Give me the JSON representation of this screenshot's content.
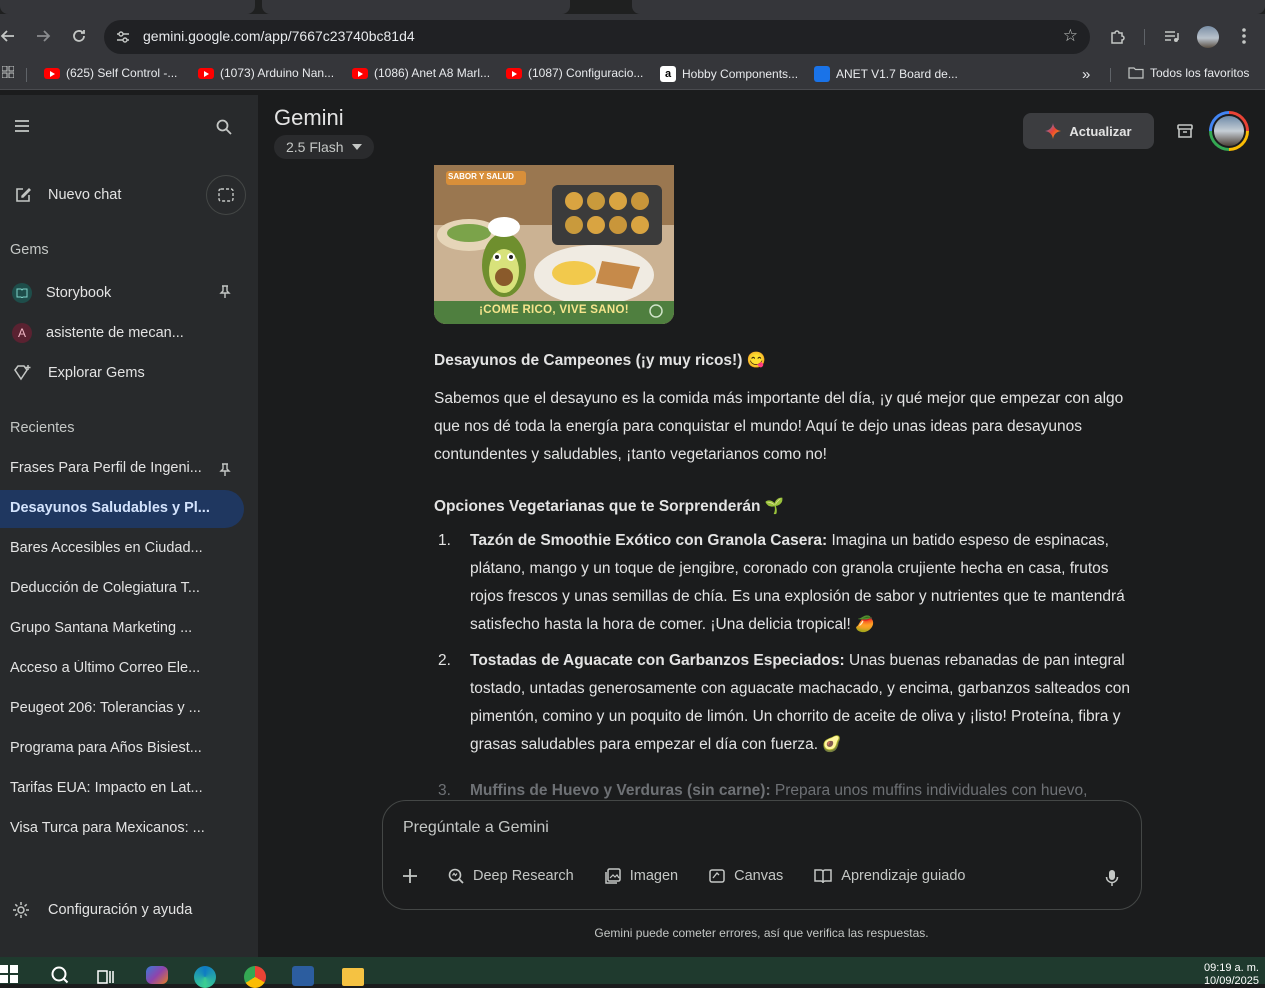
{
  "browser": {
    "url": "gemini.google.com/app/7667c23740bc81d4",
    "bookmarks": [
      {
        "icon": "youtube-icon",
        "label": "(625) Self Control -..."
      },
      {
        "icon": "youtube-icon",
        "label": "(1073) Arduino Nan..."
      },
      {
        "icon": "youtube-icon",
        "label": "(1086) Anet A8 Marl..."
      },
      {
        "icon": "youtube-icon",
        "label": "(1087) Configuracio..."
      },
      {
        "icon": "amazon-icon",
        "label": "Hobby Components..."
      },
      {
        "icon": "globe-icon",
        "label": "ANET V1.7 Board de..."
      }
    ],
    "all_bookmarks": "Todos los favoritos"
  },
  "sidebar": {
    "new_chat": "Nuevo chat",
    "gems_title": "Gems",
    "gems": [
      {
        "icon": "storybook-icon",
        "label": "Storybook"
      },
      {
        "icon": "avatar-a",
        "label": "asistente de mecan..."
      },
      {
        "icon": "gem-plus-icon",
        "label": "Explorar Gems"
      }
    ],
    "avatar_letter": "A",
    "recents_title": "Recientes",
    "recents": [
      "Frases Para Perfil de Ingeni...",
      "Desayunos Saludables y Pl...",
      "Bares Accesibles en Ciudad...",
      "Deducción de Colegiatura T...",
      "Grupo Santana Marketing ...",
      "Acceso a Último Correo Ele...",
      "Peugeot 206: Tolerancias y ...",
      "Programa para Años Bisiest...",
      "Tarifas EUA: Impacto en Lat...",
      "Visa Turca para Mexicanos: ..."
    ],
    "settings": "Configuración y ayuda"
  },
  "header": {
    "brand": "Gemini",
    "model": "2.5 Flash",
    "upgrade": "Actualizar"
  },
  "image": {
    "badge": "SABOR Y SALUD",
    "caption": "¡COME RICO, VIVE SANO!"
  },
  "response": {
    "heading": "Desayunos de Campeones (¡y muy ricos!) 😋",
    "intro": "Sabemos que el desayuno es la comida más importante del día, ¡y qué mejor que empezar con algo que nos dé toda la energía para conquistar el mundo! Aquí te dejo unas ideas para desayunos contundentes y saludables, ¡tanto vegetarianos como no!",
    "subheading": "Opciones Vegetarianas que te Sorprenderán 🌱",
    "items": [
      {
        "num": "1.",
        "title": "Tazón de Smoothie Exótico con Granola Casera:",
        "text": " Imagina un batido espeso de espinacas, plátano, mango y un toque de jengibre, coronado con granola crujiente hecha en casa, frutos rojos frescos y unas semillas de chía. Es una explosión de sabor y nutrientes que te mantendrá satisfecho hasta la hora de comer. ¡Una delicia tropical! 🥭"
      },
      {
        "num": "2.",
        "title": "Tostadas de Aguacate con Garbanzos Especiados:",
        "text": " Unas buenas rebanadas de pan integral tostado, untadas generosamente con aguacate machacado, y encima, garbanzos salteados con pimentón, comino y un poquito de limón. Un chorrito de aceite de oliva y ¡listo! Proteína, fibra y grasas saludables para empezar el día con fuerza. 🥑"
      }
    ],
    "partial": {
      "num": "3.",
      "title": "Muffins de Huevo y Verduras (sin carne):",
      "text": " Prepara unos muffins individuales con huevo,"
    }
  },
  "composer": {
    "placeholder": "Pregúntale a Gemini",
    "tools": [
      "Deep Research",
      "Imagen",
      "Canvas",
      "Aprendizaje guiado"
    ]
  },
  "disclaimer": "Gemini puede cometer errores, así que verifica las respuestas.",
  "taskbar": {
    "time": "09:19 a. m.",
    "date": "10/09/2025"
  }
}
